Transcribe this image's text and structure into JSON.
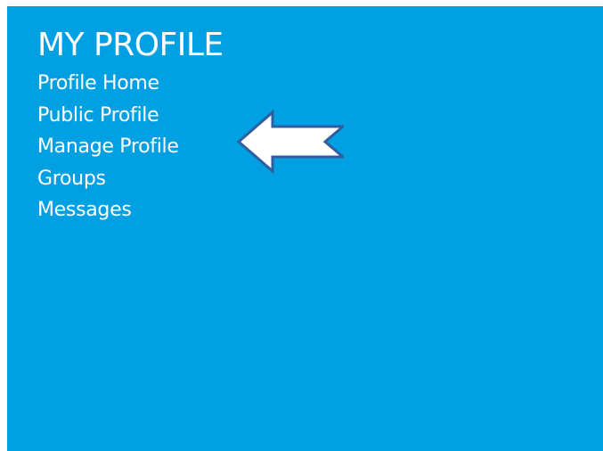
{
  "profile_menu": {
    "title": "MY PROFILE",
    "items": [
      {
        "label": "Profile Home"
      },
      {
        "label": "Public Profile"
      },
      {
        "label": "Manage Profile"
      },
      {
        "label": "Groups"
      },
      {
        "label": "Messages"
      }
    ],
    "callout": {
      "icon": "left-arrow-icon",
      "points_to": "Manage Profile"
    }
  },
  "colors": {
    "panel_background": "#00a0e3",
    "text": "#ffffff",
    "arrow_fill": "#ffffff",
    "arrow_outline": "#2f5ea0"
  }
}
